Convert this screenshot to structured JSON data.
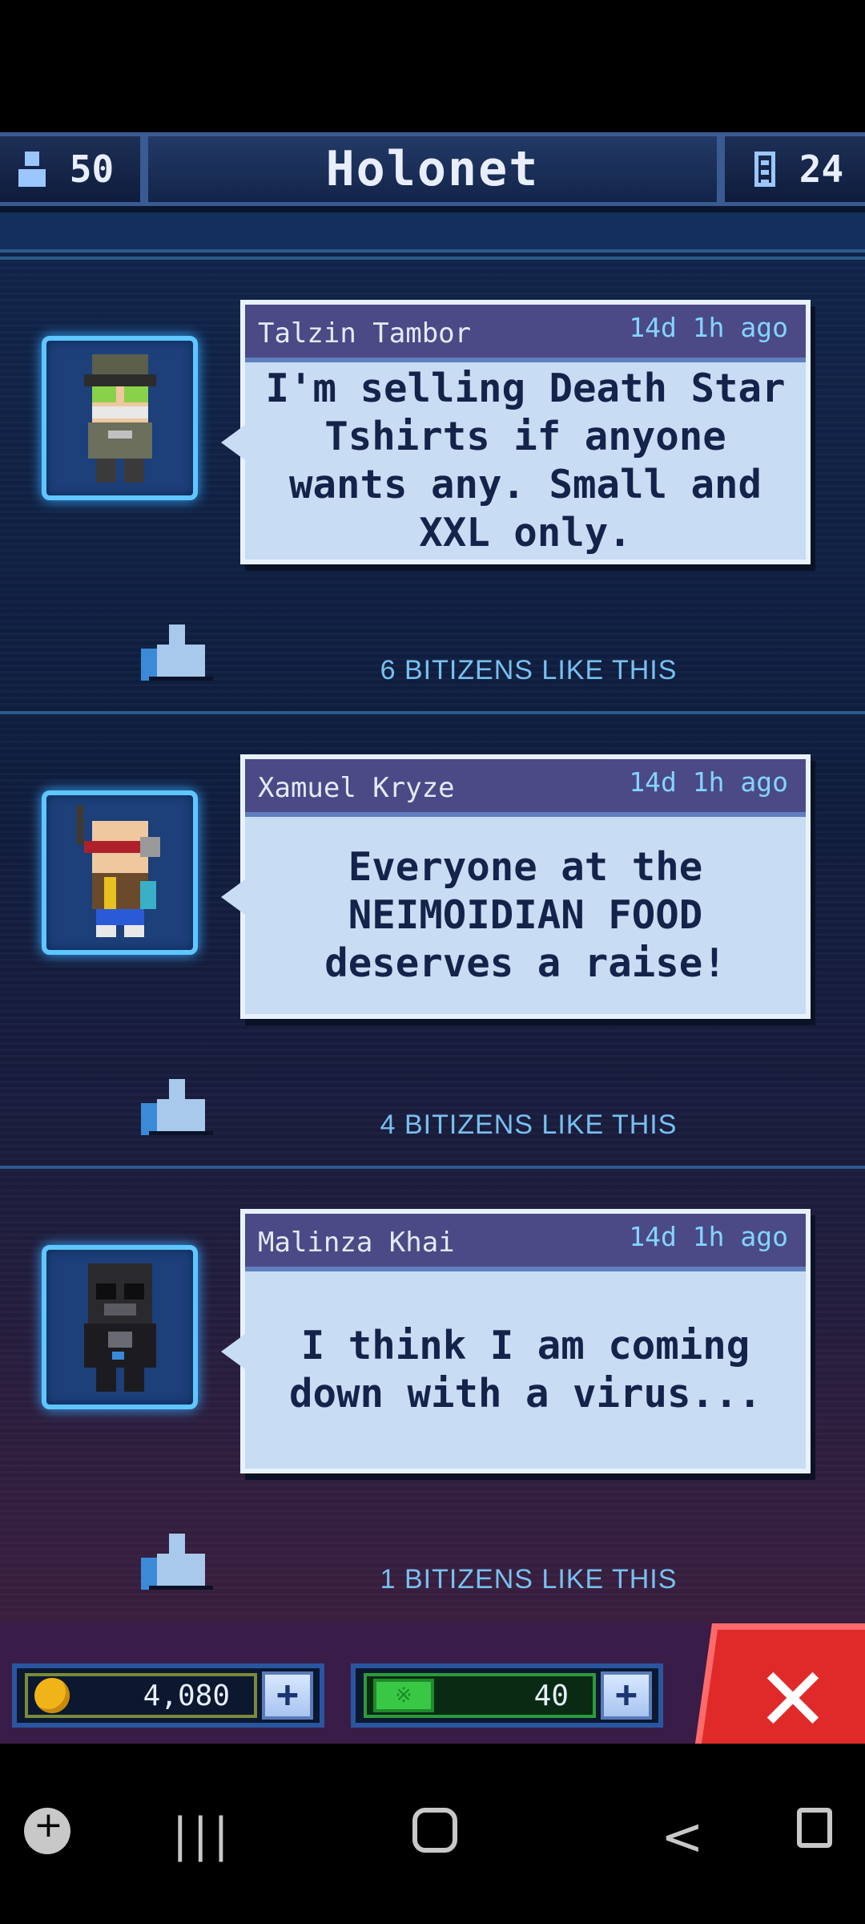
{
  "header": {
    "population": "50",
    "title": "Holonet",
    "floors": "24"
  },
  "posts": [
    {
      "author": "Talzin Tambor",
      "time": "14d 1h ago",
      "message": "I'm selling Death Star Tshirts if anyone wants any. Small and XXL only.",
      "likes": "6 BITIZENS LIKE THIS",
      "avatar": "soldier-with-goggles-avatar"
    },
    {
      "author": "Xamuel Kryze",
      "time": "14d 1h ago",
      "message": "Everyone at the NEIMOIDIAN FOOD deserves a raise!",
      "likes": "4 BITIZENS LIKE THIS",
      "avatar": "bald-man-with-visor-avatar"
    },
    {
      "author": "Malinza Khai",
      "time": "14d 1h ago",
      "message": "I think I am coming down with a virus...",
      "likes": "1 BITIZENS LIKE THIS",
      "avatar": "tie-pilot-avatar"
    }
  ],
  "currency": {
    "coins": "4,080",
    "bux": "40"
  },
  "colors": {
    "accent": "#5fc6ff",
    "close": "#e02a2a",
    "bubble": "#c8dcf4"
  }
}
